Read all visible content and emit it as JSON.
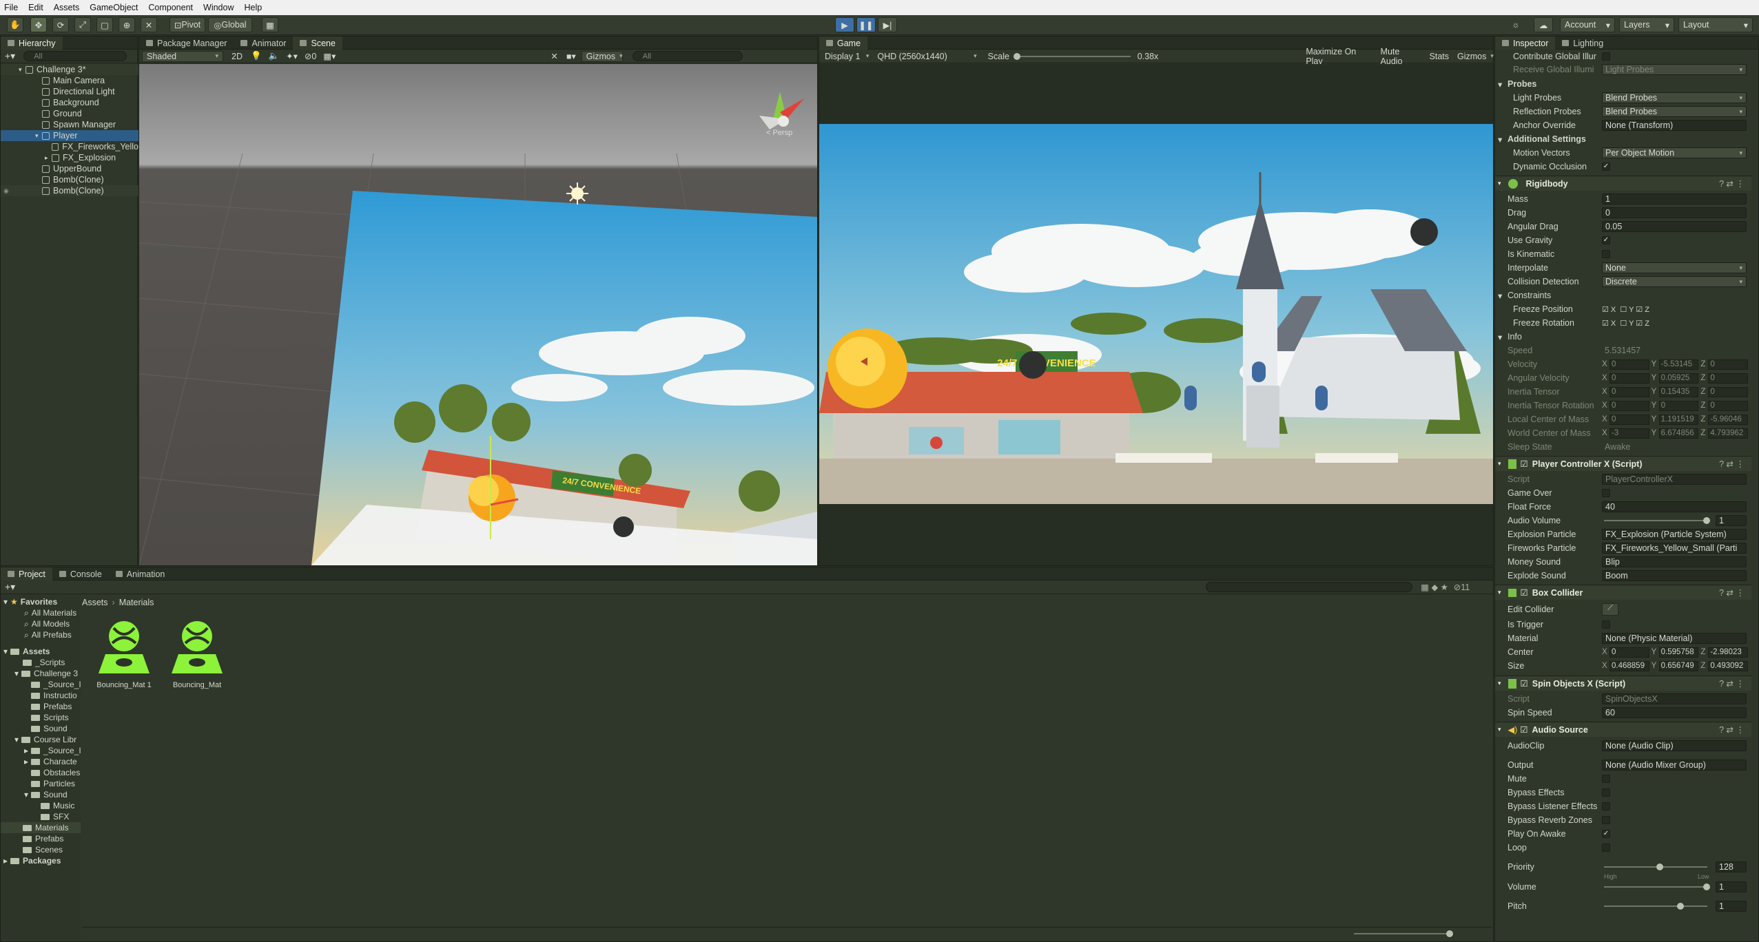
{
  "menu": [
    "File",
    "Edit",
    "Assets",
    "GameObject",
    "Component",
    "Window",
    "Help"
  ],
  "toolbar": {
    "pivot": "Pivot",
    "global": "Global",
    "account": "Account",
    "layers": "Layers",
    "layout": "Layout"
  },
  "hierarchy": {
    "tab": "Hierarchy",
    "search": "All",
    "scene": "Challenge 3*",
    "items": [
      "Main Camera",
      "Directional Light",
      "Background",
      "Ground",
      "Spawn Manager",
      "Player",
      "FX_Fireworks_Yello",
      "FX_Explosion",
      "UpperBound",
      "Bomb(Clone)",
      "Bomb(Clone)"
    ]
  },
  "scene": {
    "tabs": [
      "Package Manager",
      "Animator",
      "Scene"
    ],
    "shading": "Shaded",
    "mode2d": "2D",
    "gizmos": "Gizmos",
    "search": "All",
    "persp": "< Persp"
  },
  "game": {
    "tab": "Game",
    "display": "Display 1",
    "resolution": "QHD (2560x1440)",
    "scale_label": "Scale",
    "scale_value": "0.38x",
    "maximize": "Maximize On Play",
    "mute": "Mute Audio",
    "stats": "Stats",
    "gizmos": "Gizmos"
  },
  "scene_sign": "24/7 CONVENIENCE",
  "inspector": {
    "tabs": [
      "Inspector",
      "Lighting"
    ],
    "rows_top": [
      [
        "Contribute Global Illur",
        ""
      ],
      [
        "Receive Global Illumi",
        "Light Probes"
      ]
    ],
    "probes": {
      "header": "Probes",
      "light_probes": [
        "Light Probes",
        "Blend Probes"
      ],
      "reflection": [
        "Reflection Probes",
        "Blend Probes"
      ],
      "anchor": [
        "Anchor Override",
        "None (Transform)"
      ]
    },
    "additional": {
      "header": "Additional Settings",
      "motion": [
        "Motion Vectors",
        "Per Object Motion"
      ],
      "occlusion": "Dynamic Occlusion"
    },
    "rigidbody": {
      "title": "Rigidbody",
      "mass": [
        "Mass",
        "1"
      ],
      "drag": [
        "Drag",
        "0"
      ],
      "angular": [
        "Angular Drag",
        "0.05"
      ],
      "gravity": "Use Gravity",
      "kinematic": "Is Kinematic",
      "interpolate": [
        "Interpolate",
        "None"
      ],
      "collision": [
        "Collision Detection",
        "Discrete"
      ],
      "constraints": "Constraints",
      "freeze_pos": "Freeze Position",
      "freeze_rot": "Freeze Rotation",
      "info": "Info",
      "speed": [
        "Speed",
        "5.531457"
      ],
      "velocity": [
        "Velocity",
        "0",
        "-5.53145",
        "0"
      ],
      "ang_vel": [
        "Angular Velocity",
        "0",
        "0.05925",
        "0"
      ],
      "inertia": [
        "Inertia Tensor",
        "0",
        "0.15435",
        "0"
      ],
      "inertia_rot": [
        "Inertia Tensor Rotation",
        "0",
        "0",
        "0"
      ],
      "local_com": [
        "Local Center of Mass",
        "0",
        "1.191519",
        "-5.96046"
      ],
      "world_com": [
        "World Center of Mass",
        "-3",
        "6.674856",
        "4.793962"
      ],
      "sleep": [
        "Sleep State",
        "Awake"
      ]
    },
    "player": {
      "title": "Player Controller X (Script)",
      "script": [
        "Script",
        "PlayerControllerX"
      ],
      "game_over": "Game Over",
      "float": [
        "Float Force",
        "40"
      ],
      "audio": [
        "Audio Volume",
        "1"
      ],
      "explosion": [
        "Explosion Particle",
        "FX_Explosion (Particle System)"
      ],
      "fireworks": [
        "Fireworks Particle",
        "FX_Fireworks_Yellow_Small (Parti"
      ],
      "money": [
        "Money Sound",
        "Blip"
      ],
      "explode": [
        "Explode Sound",
        "Boom"
      ]
    },
    "box": {
      "title": "Box Collider",
      "edit": "Edit Collider",
      "trigger": "Is Trigger",
      "material": [
        "Material",
        "None (Physic Material)"
      ],
      "center": [
        "Center",
        "0",
        "0.595758",
        "-2.98023"
      ],
      "size": [
        "Size",
        "0.468859",
        "0.656749",
        "0.493092"
      ]
    },
    "spin": {
      "title": "Spin Objects X (Script)",
      "script": [
        "Script",
        "SpinObjectsX"
      ],
      "speed": [
        "Spin Speed",
        "60"
      ]
    },
    "audio": {
      "title": "Audio Source",
      "clip": [
        "AudioClip",
        "None (Audio Clip)"
      ],
      "output": [
        "Output",
        "None (Audio Mixer Group)"
      ],
      "mute": "Mute",
      "bypass": "Bypass Effects",
      "bypass_l": "Bypass Listener Effects",
      "bypass_r": "Bypass Reverb Zones",
      "play": "Play On Awake",
      "loop": "Loop",
      "priority": [
        "Priority",
        "128"
      ],
      "high": "High",
      "low": "Low",
      "volume": [
        "Volume",
        "1"
      ],
      "pitch": [
        "Pitch",
        "1"
      ]
    }
  },
  "project": {
    "tabs": [
      "Project",
      "Console",
      "Animation"
    ],
    "count": "11",
    "breadcrumb": [
      "Assets",
      "Materials"
    ],
    "favorites": [
      "Favorites",
      "All Materials",
      "All Models",
      "All Prefabs"
    ],
    "tree": [
      "Assets",
      "_Scripts",
      "Challenge 3",
      "_Source_I",
      "Instructio",
      "Prefabs",
      "Scripts",
      "Sound",
      "Course Libr",
      "_Source_I",
      "Characte",
      "Obstacles",
      "Particles",
      "Sound",
      "Music",
      "SFX",
      "Materials",
      "Prefabs",
      "Scenes",
      "Packages"
    ],
    "assets": [
      "Bouncing_Mat 1",
      "Bouncing_Mat"
    ]
  },
  "colors": {
    "accent": "#8cf23a",
    "selection": "#2c5d87"
  }
}
